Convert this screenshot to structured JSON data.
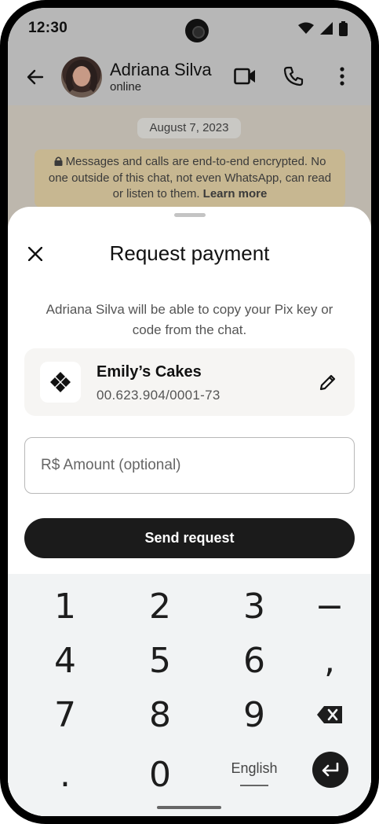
{
  "status_bar": {
    "time": "12:30"
  },
  "chat_header": {
    "contact_name": "Adriana Silva",
    "contact_status": "online"
  },
  "chat": {
    "date_chip": "August 7, 2023",
    "encryption_text": "Messages and calls are end-to-end encrypted. No one outside of this chat, not even WhatsApp, can read or listen to them.",
    "learn_more": "Learn more"
  },
  "sheet": {
    "title": "Request payment",
    "description": "Adriana Silva will be able to copy your Pix key or code from the chat.",
    "pix": {
      "name": "Emily’s Cakes",
      "key": "00.623.904/0001-73"
    },
    "amount_placeholder": "R$ Amount (optional)",
    "send_label": "Send request"
  },
  "keyboard": {
    "row1": [
      "1",
      "2",
      "3",
      "−"
    ],
    "row2": [
      "4",
      "5",
      "6",
      ","
    ],
    "row3": [
      "7",
      "8",
      "9"
    ],
    "row4": [
      ".",
      "0"
    ],
    "language": "English"
  },
  "colors": {
    "button": "#1b1b1b",
    "overlay": "#b7b7b7",
    "banner": "#c7b791",
    "keyboard_bg": "#f1f3f4"
  },
  "icons": [
    "back-arrow-icon",
    "video-call-icon",
    "phone-icon",
    "more-vert-icon",
    "lock-icon",
    "close-icon",
    "pix-logo-icon",
    "edit-pencil-icon",
    "backspace-icon",
    "enter-icon",
    "wifi-icon",
    "signal-icon",
    "battery-icon"
  ]
}
